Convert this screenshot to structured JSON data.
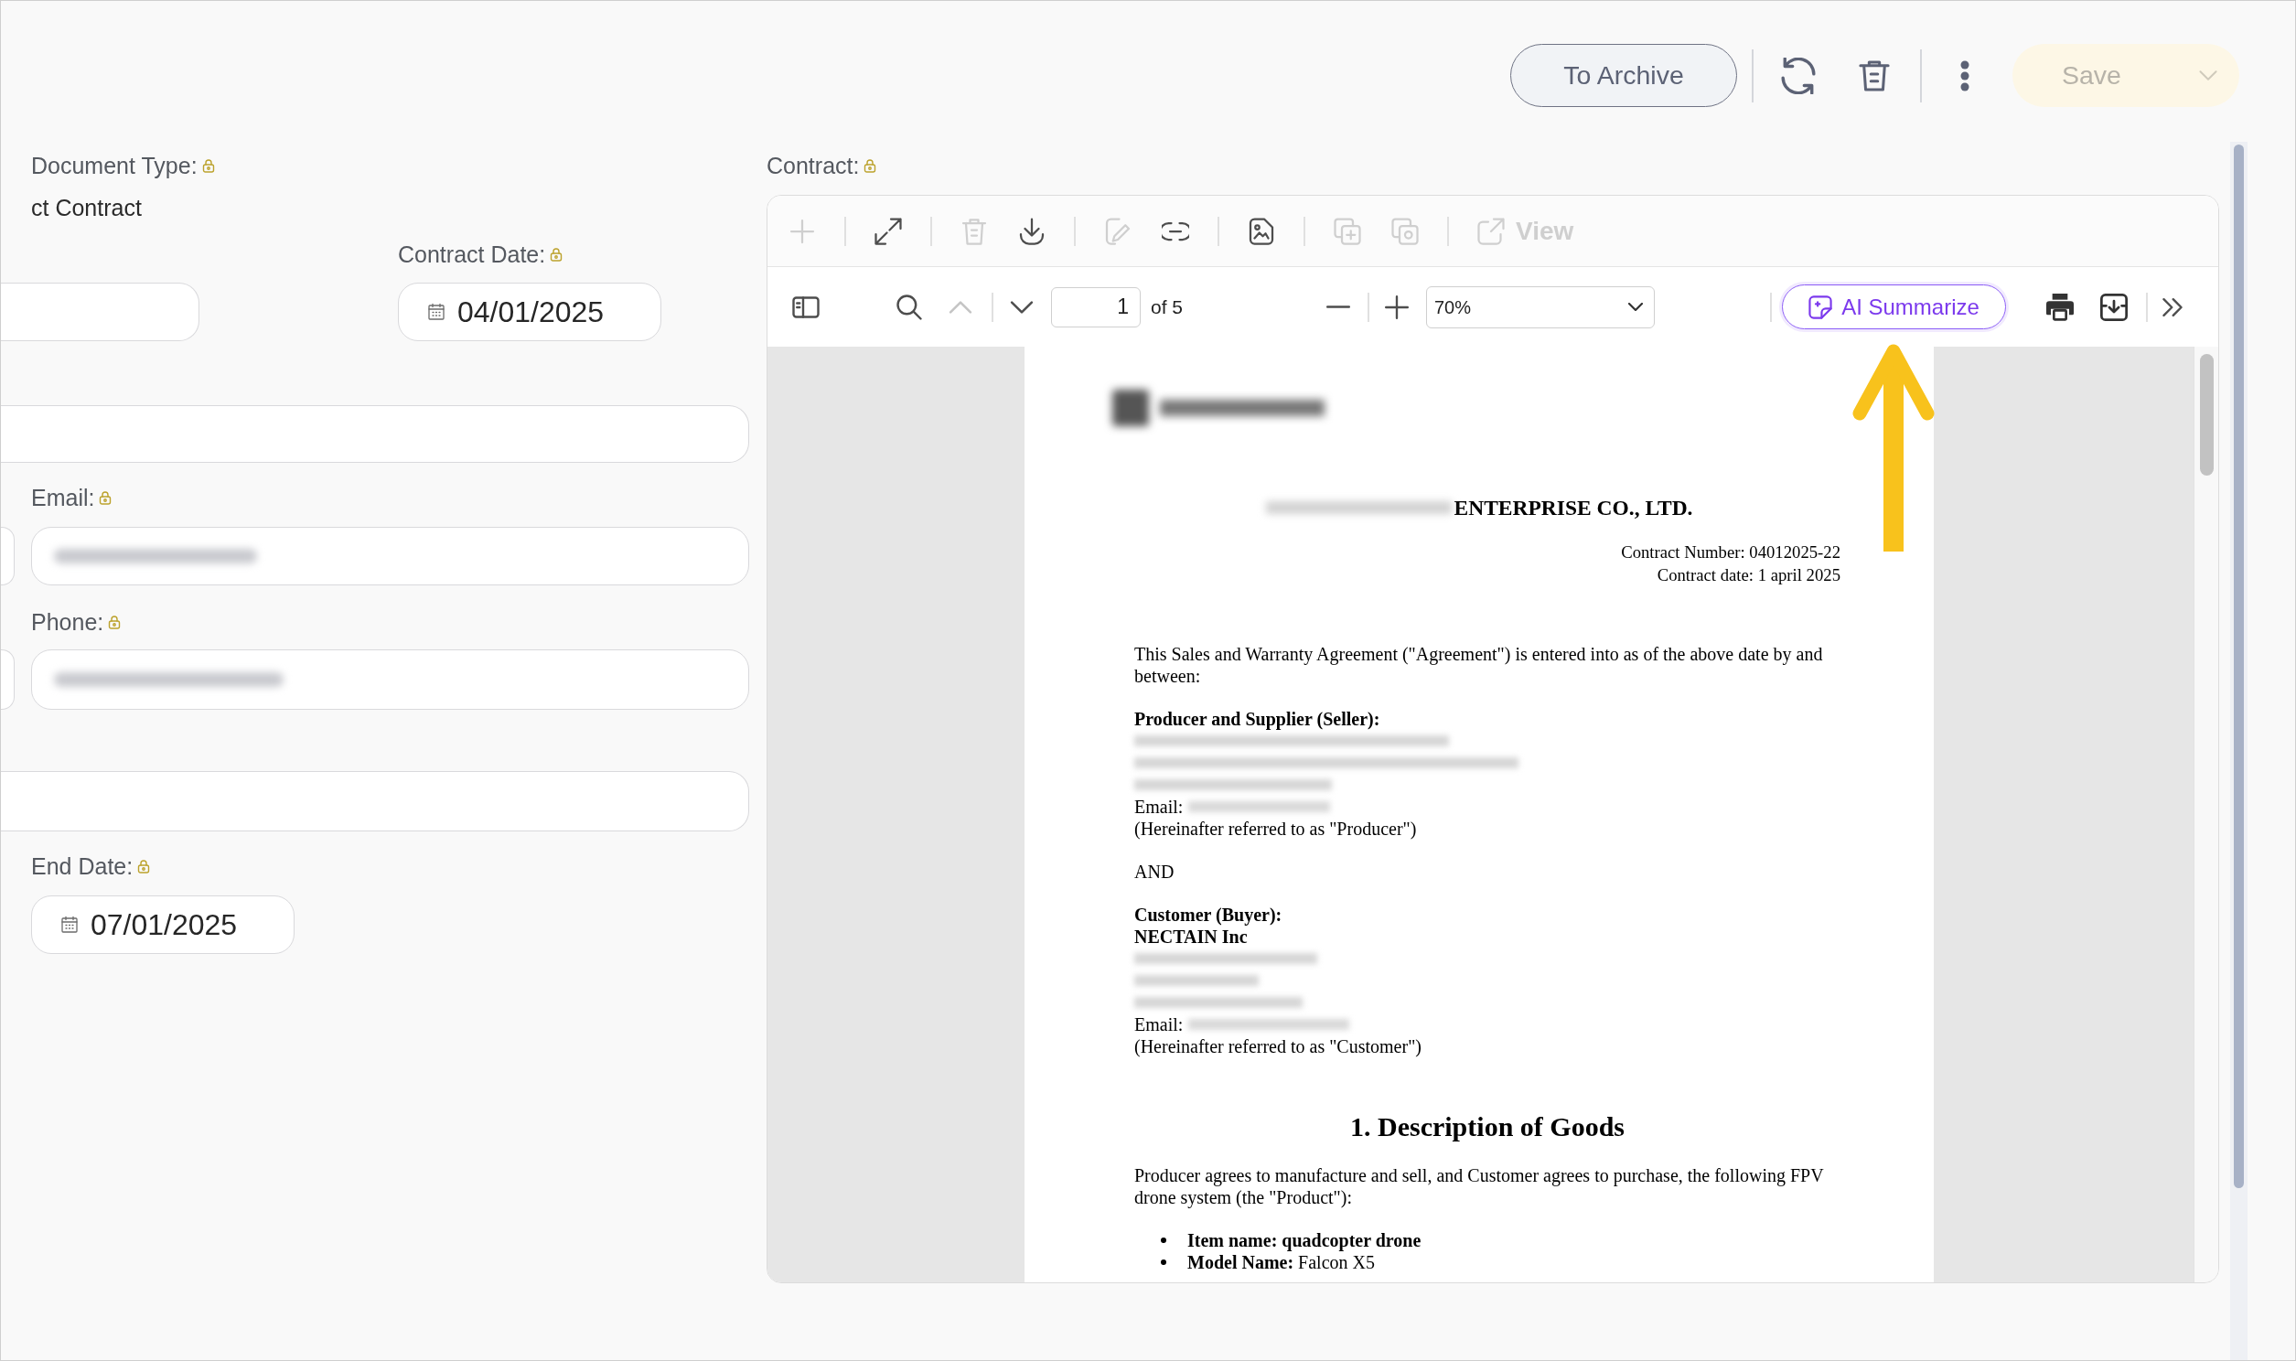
{
  "header": {
    "archive_button": {
      "label": "To Archive"
    },
    "save_button": {
      "label": "Save",
      "disabled": true
    }
  },
  "form": {
    "document_type": {
      "label": "Document Type:",
      "locked": true,
      "value": "ct Contract"
    },
    "contract_date": {
      "label": "Contract Date:",
      "locked": true,
      "value": "04/01/2025"
    },
    "email": {
      "label": "Email:",
      "locked": true,
      "redacted": true
    },
    "phone": {
      "label": "Phone:",
      "locked": true,
      "redacted": true
    },
    "end_date": {
      "label": "End Date:",
      "locked": true,
      "value": "07/01/2025"
    }
  },
  "viewer": {
    "label": "Contract:",
    "locked": true,
    "tool_groups": [
      [
        {
          "kind": "add",
          "disabled": true
        }
      ],
      [
        {
          "kind": "fullscreen",
          "disabled": false
        }
      ],
      [
        {
          "kind": "delete",
          "disabled": true
        },
        {
          "kind": "download",
          "disabled": false
        }
      ],
      [
        {
          "kind": "sign",
          "disabled": true
        },
        {
          "kind": "link",
          "disabled": false
        }
      ],
      [
        {
          "kind": "convert",
          "disabled": false
        }
      ],
      [
        {
          "kind": "copy",
          "disabled": true
        },
        {
          "kind": "duplicate",
          "disabled": true
        }
      ],
      [
        {
          "kind": "open",
          "label": "View",
          "disabled": true
        }
      ]
    ],
    "navigation": {
      "previous": {
        "disabled": true
      },
      "next": {
        "disabled": false
      },
      "page_input": {
        "value": "1"
      },
      "page_count": "of 5",
      "zoom_select": {
        "value": "70%"
      },
      "ai_summarize_button": {
        "label": "AI Summarize"
      }
    },
    "document": {
      "company": "ENTERPRISE CO., LTD.",
      "meta": [
        "Contract Number: 04012025-22",
        "Contract date: 1 april 2025"
      ],
      "blocks": [
        {
          "kind": "paragraph",
          "text": "This Sales and Warranty Agreement (\"Agreement\") is entered into as of the above date by and between:"
        },
        {
          "kind": "lines",
          "lines": [
            {
              "kind": "bold",
              "text": "Producer and Supplier (Seller):"
            },
            {
              "kind": "redacted"
            },
            {
              "kind": "redacted"
            },
            {
              "kind": "redacted"
            },
            {
              "kind": "email",
              "label": "Email:"
            },
            {
              "kind": "plain",
              "text": "(Hereinafter referred to as \"Producer\")"
            }
          ]
        },
        {
          "kind": "lines",
          "lines": [
            {
              "kind": "plain",
              "text": "AND"
            }
          ]
        },
        {
          "kind": "lines",
          "lines": [
            {
              "kind": "bold",
              "text": "Customer (Buyer):"
            },
            {
              "kind": "bold",
              "text": "NECTAIN Inc"
            },
            {
              "kind": "redacted"
            },
            {
              "kind": "redacted"
            },
            {
              "kind": "redacted"
            },
            {
              "kind": "email",
              "label": "Email:"
            },
            {
              "kind": "plain",
              "text": "(Hereinafter referred to as \"Customer\")"
            }
          ]
        },
        {
          "kind": "section_title",
          "text": "1. Description of Goods"
        },
        {
          "kind": "paragraph",
          "text": "Producer agrees to manufacture and sell, and Customer agrees to purchase, the following FPV drone system (the \"Product\"):"
        },
        {
          "kind": "bullets",
          "items": [
            "**Item name: quadcopter drone**",
            "**Model Name:** Falcon X5"
          ]
        }
      ]
    }
  }
}
